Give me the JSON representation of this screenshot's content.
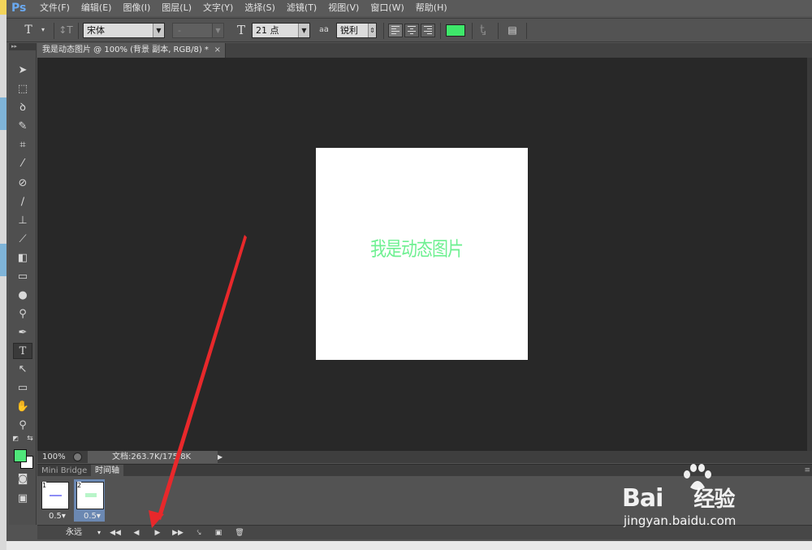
{
  "menubar": {
    "logo": "Ps",
    "items": [
      "文件(F)",
      "编辑(E)",
      "图像(I)",
      "图层(L)",
      "文字(Y)",
      "选择(S)",
      "滤镜(T)",
      "视图(V)",
      "窗口(W)",
      "帮助(H)"
    ]
  },
  "options": {
    "font_family": "宋体",
    "font_style": "-",
    "font_size": "21 点",
    "antialias_label": "a",
    "antialias": "锐利",
    "text_color": "#3ee86a"
  },
  "document": {
    "tab_title": "我是动态图片 @ 100% (背景 副本, RGB/8) *",
    "close": "×",
    "canvas_text": "我是动态图片",
    "text_color": "#6ef091"
  },
  "status": {
    "zoom": "100%",
    "doc_info": "文档:263.7K/175.8K"
  },
  "panel": {
    "tabs": [
      "Mini Bridge",
      "时间轴"
    ],
    "frames": [
      {
        "number": "1",
        "delay": "0.5▾"
      },
      {
        "number": "2",
        "delay": "0.5▾"
      }
    ],
    "loop": "永远"
  },
  "watermark": {
    "brand": "Bai",
    "brand_cn": "经验",
    "url": "jingyan.baidu.com"
  },
  "colors": {
    "foreground": "#4fe77a",
    "background": "#ffffff",
    "arrow": "#e8282b"
  }
}
